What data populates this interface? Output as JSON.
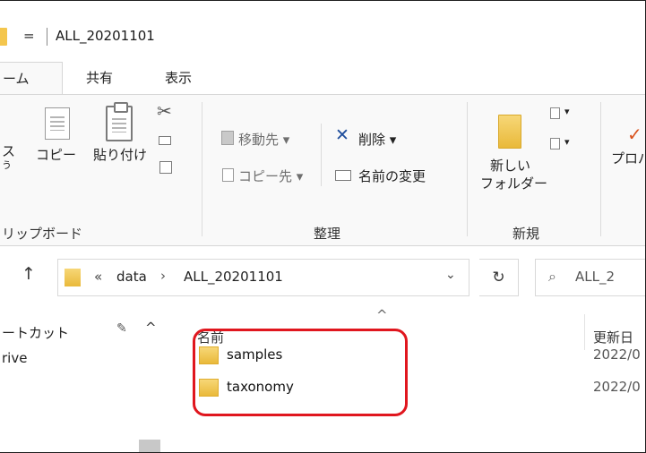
{
  "window": {
    "qa_symbol": "=",
    "title": "ALL_20201101"
  },
  "tabs": [
    {
      "label": "ホーム",
      "visible": "ーム"
    },
    {
      "label": "共有"
    },
    {
      "label": "表示"
    }
  ],
  "ribbon": {
    "clipboard": {
      "pin_label_partial": "ス",
      "pin_label_partial2": "う",
      "copy_label": "コピー",
      "paste_label": "貼り付け",
      "group_label": "リップボード"
    },
    "organize": {
      "move_to_label": "移動先 ▾",
      "copy_to_label": "コピー先 ▾",
      "delete_label": "削除 ▾",
      "rename_label": "名前の変更",
      "group_label": "整理"
    },
    "new": {
      "new_folder_line1": "新しい",
      "new_folder_line2": "フォルダー",
      "group_label": "新規"
    },
    "open": {
      "properties_partial": "プロパ"
    }
  },
  "address": {
    "chevrons": "«",
    "crumbs": [
      "data",
      "ALL_20201101"
    ],
    "separator": "›",
    "dropdown": "⌄",
    "refresh": "↻"
  },
  "search": {
    "placeholder_partial": "ALL_2"
  },
  "nav": {
    "quick_access_partial": "ートカット",
    "pin": "📌",
    "caret": "^",
    "drive_partial": "rive"
  },
  "filelist": {
    "sort_indicator": "^",
    "columns": {
      "name": "名前",
      "date_partial": "更新日"
    },
    "rows": [
      {
        "name": "samples",
        "date_partial": "2022/0"
      },
      {
        "name": "taxonomy",
        "date_partial": "2022/0"
      }
    ]
  },
  "colors": {
    "accent_highlight": "#e0161e",
    "folder": "#f4c64d",
    "delete_x": "#1f4e9c"
  }
}
